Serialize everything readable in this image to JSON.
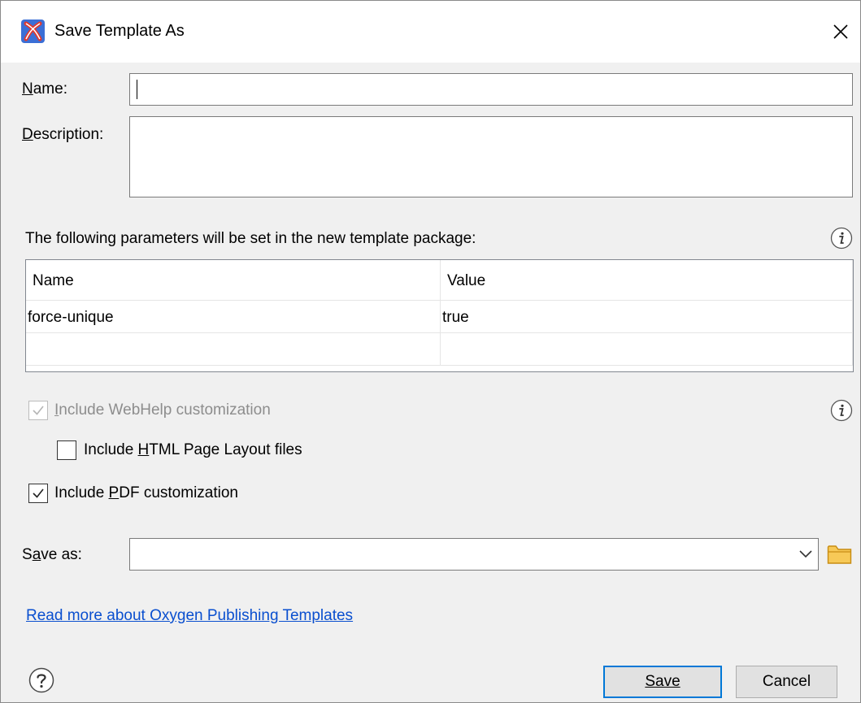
{
  "window": {
    "title": "Save Template As"
  },
  "form": {
    "name_label": "Name:",
    "name_value": "",
    "description_label": "Description:",
    "description_value": "",
    "params_text": "The following parameters will be set in the new template package:"
  },
  "table": {
    "columns": [
      "Name",
      "Value"
    ],
    "rows": [
      {
        "name": "force-unique",
        "value": "true"
      },
      {
        "name": "",
        "value": ""
      }
    ]
  },
  "options": {
    "webhelp": {
      "label": "Include WebHelp customization",
      "checked": true,
      "enabled": false
    },
    "html_layout": {
      "label": "Include HTML Page Layout files",
      "checked": false,
      "enabled": true
    },
    "pdf": {
      "label": "Include PDF customization",
      "checked": true,
      "enabled": true
    }
  },
  "save_as": {
    "label": "Save as:",
    "value": ""
  },
  "link": {
    "text": "Read more about Oxygen Publishing Templates"
  },
  "buttons": {
    "save": "Save",
    "cancel": "Cancel"
  },
  "icons": {
    "app": "oxygen-app-icon",
    "close": "close-icon",
    "info": "info-icon",
    "dropdown": "chevron-down-icon",
    "browse": "folder-icon",
    "help": "help-icon"
  },
  "colors": {
    "accent": "#0078d7",
    "link": "#0a4fcf",
    "folder": "#e8b33b",
    "app_icon": "#d9322b"
  }
}
